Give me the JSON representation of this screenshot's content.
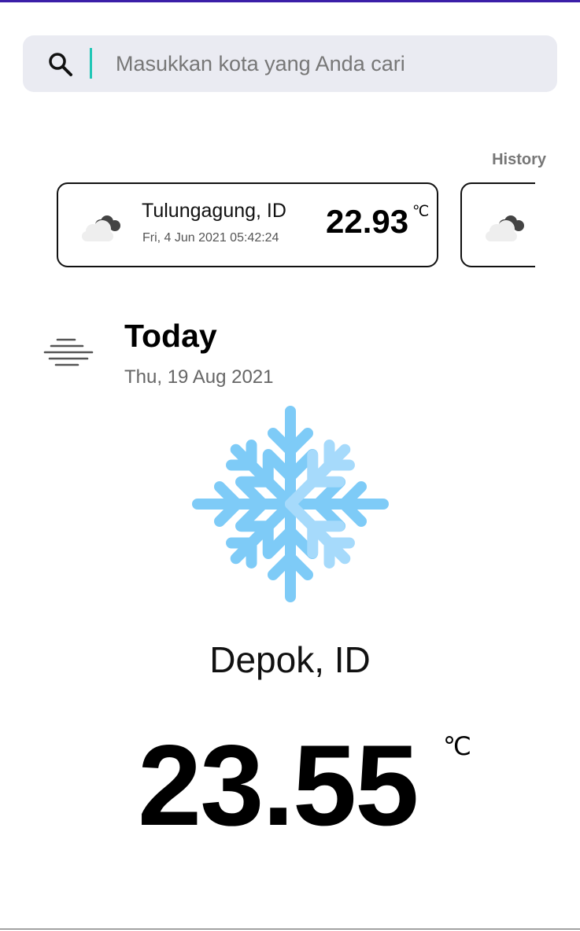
{
  "search": {
    "placeholder": "Masukkan kota yang Anda cari",
    "icon": "search-icon"
  },
  "history": {
    "label": "History",
    "items": [
      {
        "city": "Tulungagung, ID",
        "datetime": "Fri, 4 Jun 2021 05:42:24",
        "temp": "22.93",
        "unit": "℃",
        "icon": "cloudy-icon"
      },
      {
        "city": "",
        "datetime": "",
        "temp": "",
        "unit": "",
        "icon": "cloudy-icon"
      }
    ]
  },
  "today": {
    "label": "Today",
    "date": "Thu, 19 Aug 2021",
    "condition_icon": "fog-icon",
    "weather_icon": "snowflake-icon",
    "location": "Depok, ID",
    "temp": "23.55",
    "unit": "℃"
  },
  "colors": {
    "accent_top": "#3b1fa8",
    "search_bg": "#eaebf2",
    "caret": "#20c6b6",
    "snow_main": "#7ecbf7",
    "snow_light": "#a6dafb"
  }
}
